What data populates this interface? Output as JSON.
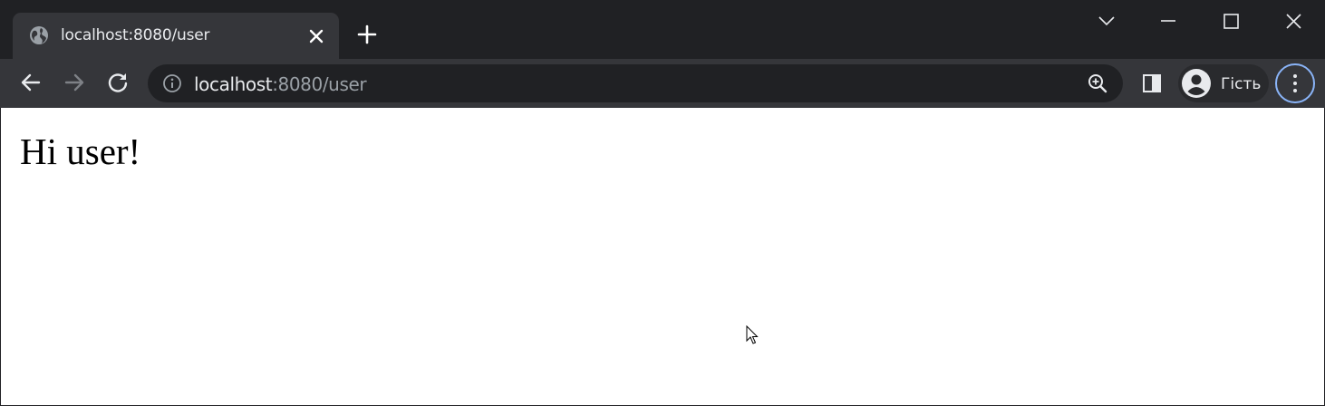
{
  "tab": {
    "title": "localhost:8080/user"
  },
  "address_bar": {
    "host": "localhost",
    "path": ":8080/user"
  },
  "profile": {
    "label": "Гість"
  },
  "page": {
    "heading": "Hi user!"
  },
  "colors": {
    "titlebar": "#202124",
    "toolbar": "#35363a",
    "focus_ring": "#8ab4f8",
    "page_background": "#ffffff"
  },
  "icons": [
    "globe-icon",
    "close-icon",
    "plus-icon",
    "chevron-down-icon",
    "minimize-icon",
    "maximize-icon",
    "close-window-icon",
    "back-arrow-icon",
    "forward-arrow-icon",
    "reload-icon",
    "info-icon",
    "zoom-in-icon",
    "side-panel-icon",
    "avatar-icon",
    "kebab-menu-icon",
    "mouse-cursor-icon"
  ]
}
